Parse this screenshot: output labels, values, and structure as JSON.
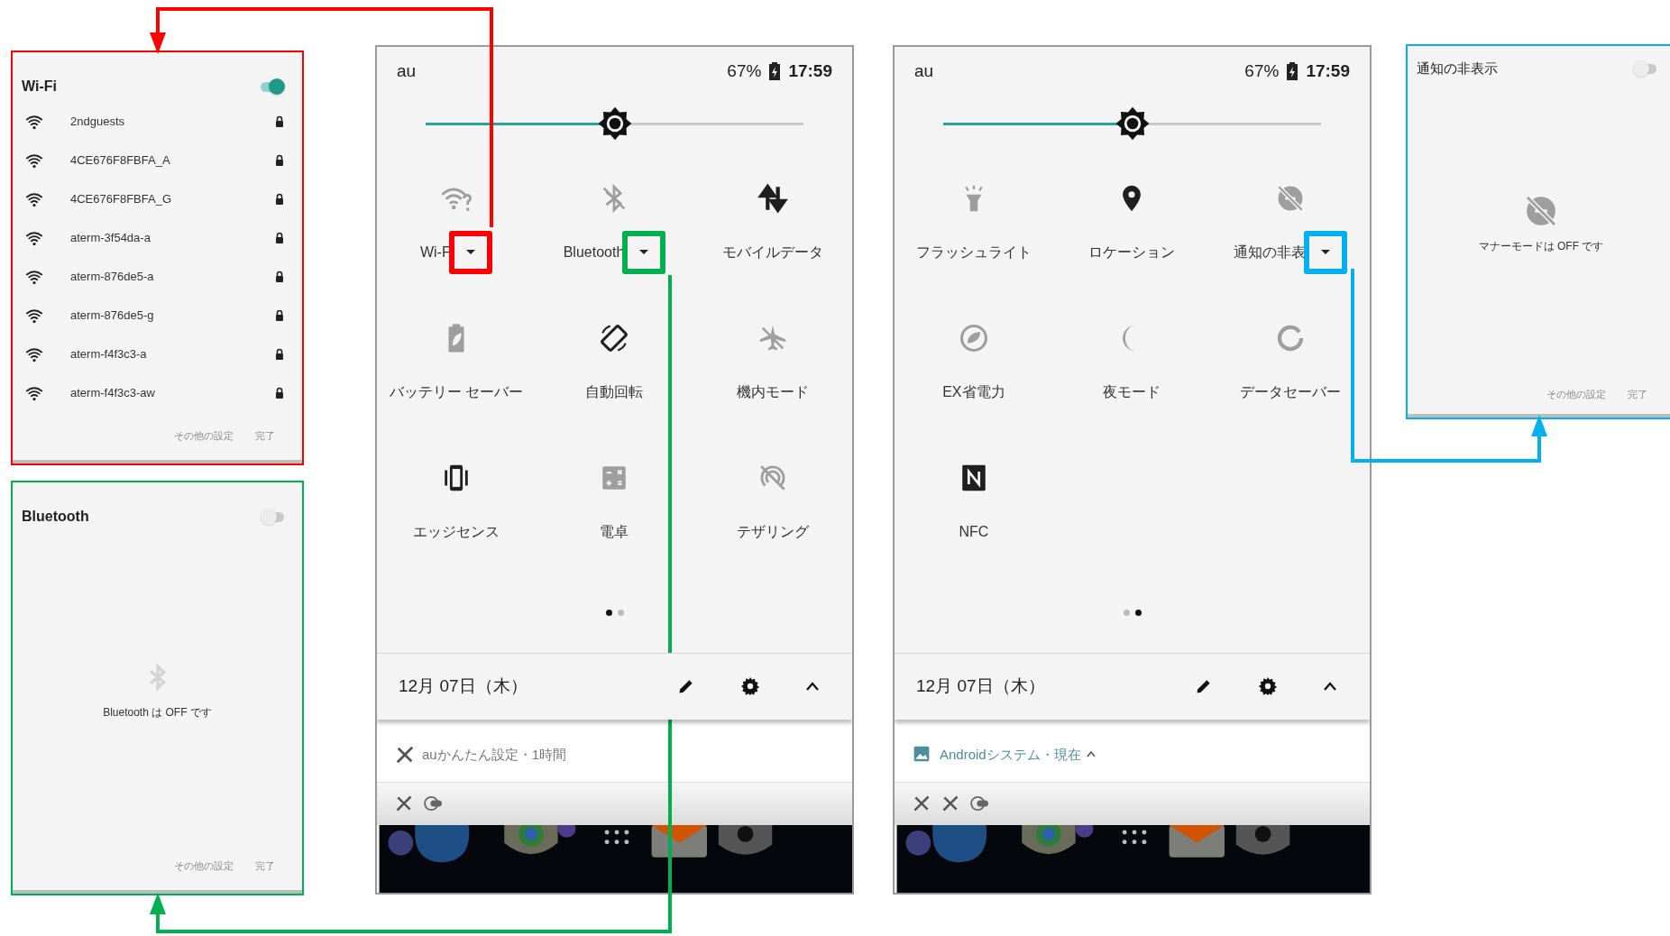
{
  "panels": [
    {
      "kind": "list",
      "color": "#ff0000",
      "title": "Wi-Fi",
      "on": true,
      "networks": [
        {
          "name": "2ndguests"
        },
        {
          "name": "4CE676F8FBFA_A"
        },
        {
          "name": "4CE676F8FBFA_G"
        },
        {
          "name": "aterm-3f54da-a"
        },
        {
          "name": "aterm-876de5-a"
        },
        {
          "name": "aterm-876de5-g"
        },
        {
          "name": "aterm-f4f3c3-a"
        },
        {
          "name": "aterm-f4f3c3-aw"
        }
      ],
      "footer": [
        "その他の設定",
        "完了"
      ]
    },
    {
      "kind": "message",
      "color": "#00b050",
      "title": "Bluetooth",
      "on": false,
      "message": "Bluetooth は OFF です",
      "footer": [
        "その他の設定",
        "完了"
      ]
    },
    {
      "kind": "message",
      "color": "#00b0f0",
      "title": "通知の非表示",
      "on": false,
      "message": "マナーモードは OFF です",
      "footer": [
        "その他の設定",
        "完了"
      ]
    }
  ],
  "phones": [
    {
      "carrier": "au",
      "battery": "67%",
      "time": "17:59",
      "brightness": {
        "level": 0.5
      },
      "tiles": [
        {
          "label": "Wi-F",
          "on": false,
          "caret": {
            "color": "#ff0000"
          }
        },
        {
          "label": "Bluetooth",
          "on": false,
          "caret": {
            "color": "#00b050"
          }
        },
        {
          "label": "モバイルデータ",
          "on": true
        },
        {
          "label": "バッテリー セーバー",
          "on": false
        },
        {
          "label": "自動回転",
          "on": true
        },
        {
          "label": "機内モード",
          "on": false
        },
        {
          "label": "エッジセンス",
          "on": true
        },
        {
          "label": "電卓",
          "on": false
        },
        {
          "label": "テザリング",
          "on": false
        }
      ],
      "page_dots": [
        {
          "selected": true
        },
        {
          "selected": false
        }
      ],
      "date": "12月 07日（木）",
      "notification": {
        "kind": "app",
        "text": "auかんたん設定・1時間"
      }
    },
    {
      "carrier": "au",
      "battery": "67%",
      "time": "17:59",
      "brightness": {
        "level": 0.5
      },
      "tiles": [
        {
          "label": "フラッシュライト",
          "on": false
        },
        {
          "label": "ロケーション",
          "on": true
        },
        {
          "label": "通知の非表",
          "on": false,
          "caret": {
            "color": "#00b0f0"
          }
        },
        {
          "label": "EX省電力",
          "on": false
        },
        {
          "label": "夜モード",
          "on": false
        },
        {
          "label": "データセーバー",
          "on": false
        },
        {
          "label": "NFC",
          "on": true
        }
      ],
      "page_dots": [
        {
          "selected": false
        },
        {
          "selected": true
        }
      ],
      "date": "12月 07日（木）",
      "notification": {
        "kind": "system",
        "text": "Androidシステム・現在"
      }
    }
  ],
  "connectors": [
    {
      "color": "#ff0000"
    },
    {
      "color": "#00b050"
    },
    {
      "color": "#00b0f0"
    }
  ]
}
